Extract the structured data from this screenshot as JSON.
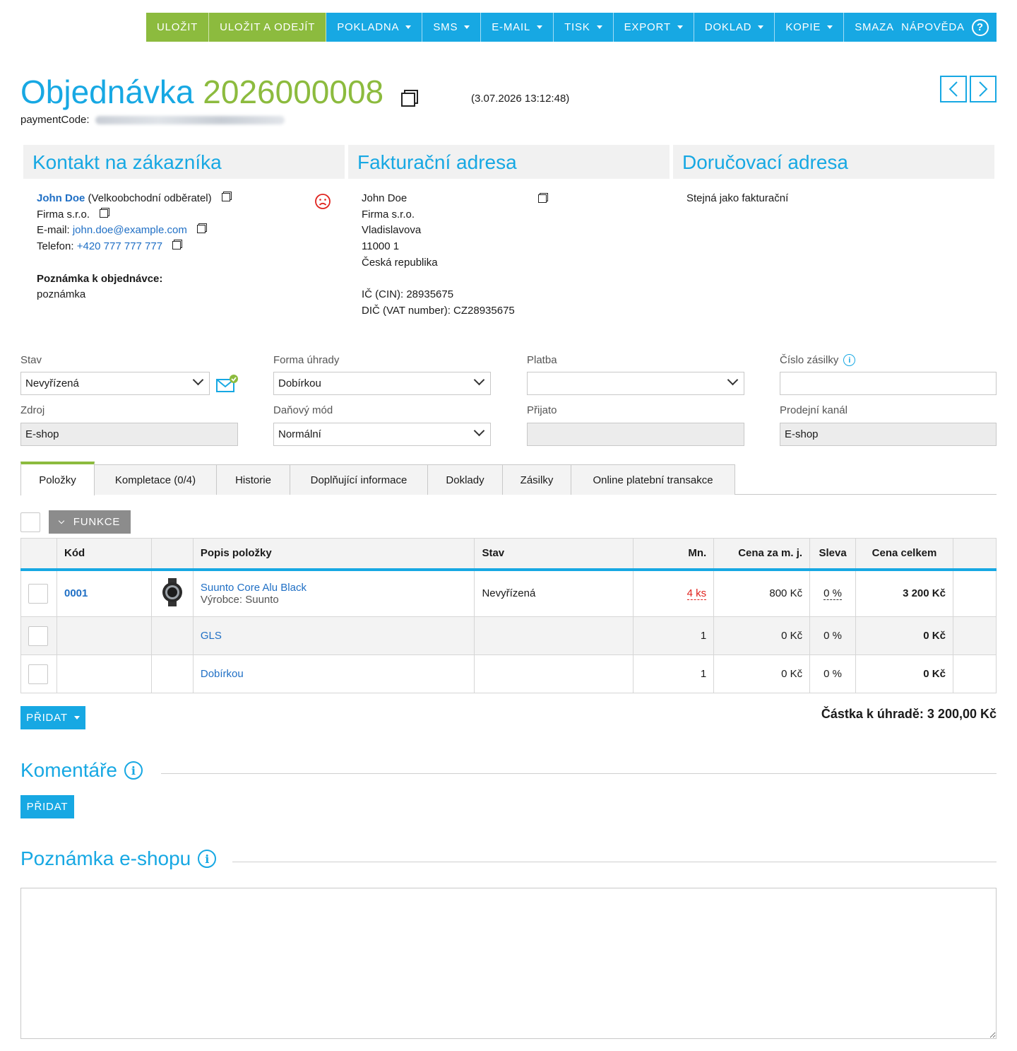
{
  "toolbar": {
    "save": "ULOŽIT",
    "save_exit": "ULOŽIT A ODEJÍT",
    "pokladna": "POKLADNA",
    "sms": "SMS",
    "email": "E-MAIL",
    "tisk": "TISK",
    "export": "EXPORT",
    "doklad": "DOKLAD",
    "kopie": "KOPIE",
    "smazat": "SMAZAT",
    "help": "NÁPOVĚDA"
  },
  "header": {
    "title_word": "Objednávka",
    "order_number": "2026000008",
    "timestamp": "(3.07.2026 13:12:48)",
    "payment_code_label": "paymentCode:"
  },
  "contact": {
    "heading": "Kontakt na zákazníka",
    "name": "John Doe",
    "customer_group": "(Velkoobchodní odběratel)",
    "company": "Firma s.r.o.",
    "email_label": "E-mail:",
    "email": "john.doe@example.com",
    "phone_label": "Telefon:",
    "phone": "+420 777 777 777",
    "note_label": "Poznámka k objednávce:",
    "note": "poznámka"
  },
  "billing": {
    "heading": "Fakturační adresa",
    "lines": [
      "John Doe",
      "Firma s.r.o.",
      "Vladislavova",
      "11000 1",
      "Česká republika"
    ],
    "ic": "IČ (CIN): 28935675",
    "dic": "DIČ (VAT number): CZ28935675"
  },
  "delivery": {
    "heading": "Doručovací adresa",
    "text": "Stejná jako fakturační"
  },
  "fields": {
    "stav_label": "Stav",
    "stav_value": "Nevyřízená",
    "forma_label": "Forma úhrady",
    "forma_value": "Dobírkou",
    "platba_label": "Platba",
    "platba_value": "",
    "zasilka_label": "Číslo zásilky",
    "zasilka_value": "",
    "zdroj_label": "Zdroj",
    "zdroj_value": "E-shop",
    "danovy_label": "Daňový mód",
    "danovy_value": "Normální",
    "prijato_label": "Přijato",
    "prijato_value": "",
    "kanal_label": "Prodejní kanál",
    "kanal_value": "E-shop"
  },
  "tabs": [
    "Položky",
    "Kompletace (0/4)",
    "Historie",
    "Doplňující informace",
    "Doklady",
    "Zásilky",
    "Online platební transakce"
  ],
  "items": {
    "funkce": "FUNKCE",
    "headers": {
      "kod": "Kód",
      "popis": "Popis položky",
      "stav": "Stav",
      "mn": "Mn.",
      "cena_mj": "Cena za m. j.",
      "sleva": "Sleva",
      "cena_celkem": "Cena celkem"
    },
    "rows": [
      {
        "kod": "0001",
        "name": "Suunto Core Alu Black",
        "sub": "Výrobce: Suunto",
        "stav": "Nevyřízená",
        "mn": "4 ks",
        "cena": "800 Kč",
        "sleva": "0 %",
        "celkem": "3 200 Kč"
      },
      {
        "kod": "",
        "name": "GLS",
        "sub": "",
        "stav": "",
        "mn": "1",
        "cena": "0 Kč",
        "sleva": "0 %",
        "celkem": "0 Kč"
      },
      {
        "kod": "",
        "name": "Dobírkou",
        "sub": "",
        "stav": "",
        "mn": "1",
        "cena": "0 Kč",
        "sleva": "0 %",
        "celkem": "0 Kč"
      }
    ],
    "add": "PŘIDAT",
    "total": "Částka k úhradě: 3 200,00 Kč"
  },
  "comments": {
    "heading": "Komentáře",
    "add": "PŘIDAT"
  },
  "eshop_note": {
    "heading": "Poznámka e-shopu",
    "value": ""
  },
  "colors": {
    "blue": "#17a8e3",
    "green": "#8cbb3e",
    "link": "#1f6fc5",
    "warning_red": "#e0231e"
  }
}
